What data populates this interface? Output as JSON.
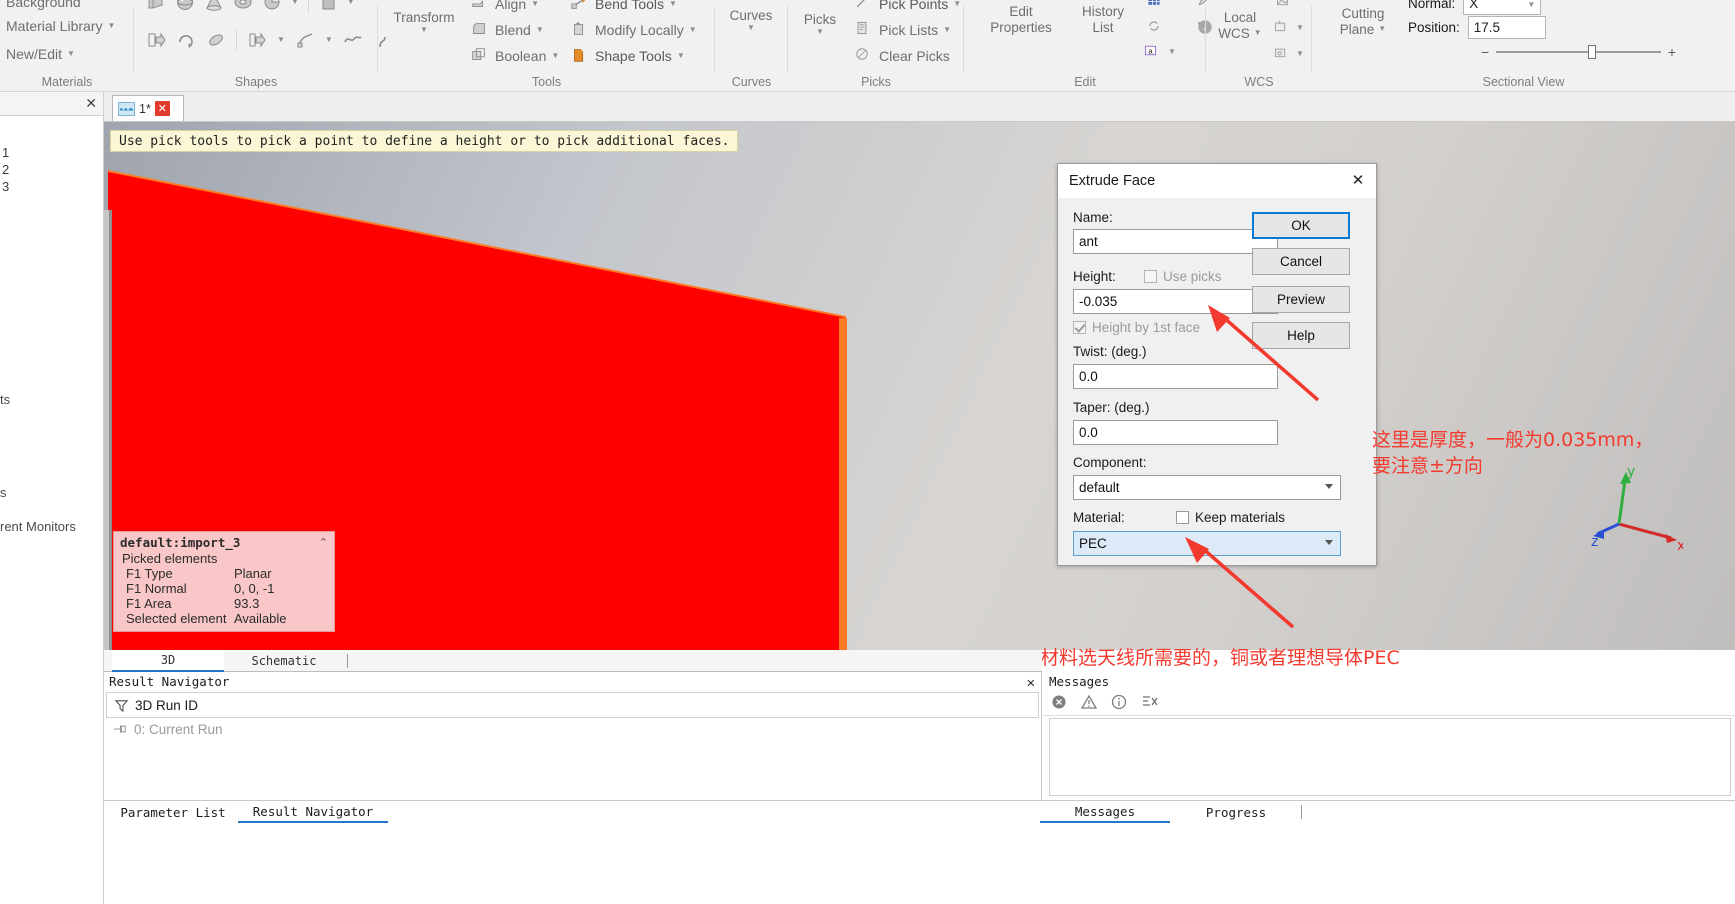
{
  "ribbon": {
    "groups": [
      {
        "label": "Materials"
      },
      {
        "label": "Shapes"
      },
      {
        "label": "Tools"
      },
      {
        "label": "Curves"
      },
      {
        "label": "Picks"
      },
      {
        "label": "Edit"
      },
      {
        "label": "WCS"
      },
      {
        "label": "Sectional View"
      }
    ],
    "materials": {
      "background": "Background",
      "material_library": "Material Library",
      "new_edit": "New/Edit"
    },
    "tools": {
      "transform": "Transform",
      "align": "Align",
      "blend": "Blend",
      "boolean": "Boolean",
      "bend_tools": "Bend Tools",
      "modify_locally": "Modify Locally",
      "shape_tools": "Shape Tools"
    },
    "curves": {
      "curves": "Curves"
    },
    "picks": {
      "picks": "Picks",
      "pick_points": "Pick Points",
      "pick_lists": "Pick Lists",
      "clear_picks": "Clear Picks"
    },
    "edit": {
      "edit_properties": "Edit\nProperties",
      "edit_properties_l1": "Edit",
      "edit_properties_l2": "Properties",
      "history_list_l1": "History",
      "history_list_l2": "List"
    },
    "wcs": {
      "local_l1": "Local",
      "local_l2": "WCS"
    },
    "sectional": {
      "cutting_l1": "Cutting",
      "cutting_l2": "Plane",
      "normal_label": "Normal:",
      "normal_value": "X",
      "position_label": "Position:",
      "position_value": "17.5",
      "minus": "−",
      "plus": "+"
    }
  },
  "left_panel": {
    "close": "✕",
    "rows": [
      "1",
      "2",
      "3"
    ],
    "items": [
      "ts",
      "s",
      "rent Monitors"
    ]
  },
  "doc_tab": {
    "title": "1*",
    "close_badge": "✕"
  },
  "viewport": {
    "hint": "Use pick tools to pick a point to define a height or to pick additional faces.",
    "infobox": {
      "title": "default:import_3",
      "collapse_icon": "⌃",
      "subtitle": "Picked elements",
      "rows": [
        {
          "key": "F1 Type",
          "value": "Planar"
        },
        {
          "key": "F1 Normal",
          "value": "0, 0, -1"
        },
        {
          "key": "F1 Area",
          "value": "93.3"
        },
        {
          "key": "Selected element",
          "value": "Available"
        }
      ]
    },
    "triad": {
      "x": "x",
      "y": "y",
      "z": "z"
    },
    "tabs": [
      {
        "label": "3D",
        "active": true
      },
      {
        "label": "Schematic",
        "active": false
      }
    ]
  },
  "dialog": {
    "title": "Extrude Face",
    "close": "✕",
    "name_label": "Name:",
    "name_value": "ant",
    "height_label": "Height:",
    "height_value": "-0.035",
    "use_picks_label": "Use picks",
    "height_by_face_label": "Height by 1st face",
    "twist_label": "Twist: (deg.)",
    "twist_value": "0.0",
    "taper_label": "Taper: (deg.)",
    "taper_value": "0.0",
    "component_label": "Component:",
    "component_value": "default",
    "material_label": "Material:",
    "keep_materials_label": "Keep materials",
    "material_value": "PEC",
    "buttons": {
      "ok": "OK",
      "cancel": "Cancel",
      "preview": "Preview",
      "help": "Help"
    }
  },
  "annotations": {
    "color": "#f23a2f",
    "thickness_line1": "这里是厚度，一般为0.035mm，",
    "thickness_line2": "要注意±方向",
    "material_note": "材料选天线所需要的，铜或者理想导体PEC"
  },
  "result_navigator": {
    "title": "Result Navigator",
    "close": "✕",
    "column_header": "3D Run ID",
    "rows": [
      "0: Current Run"
    ]
  },
  "messages": {
    "title": "Messages",
    "tabs": [
      {
        "label": "Messages",
        "active": true
      },
      {
        "label": "Progress",
        "active": false
      }
    ]
  },
  "bottom_tabs": [
    {
      "label": "Parameter List",
      "selected": false
    },
    {
      "label": "Result Navigator",
      "selected": true
    }
  ]
}
